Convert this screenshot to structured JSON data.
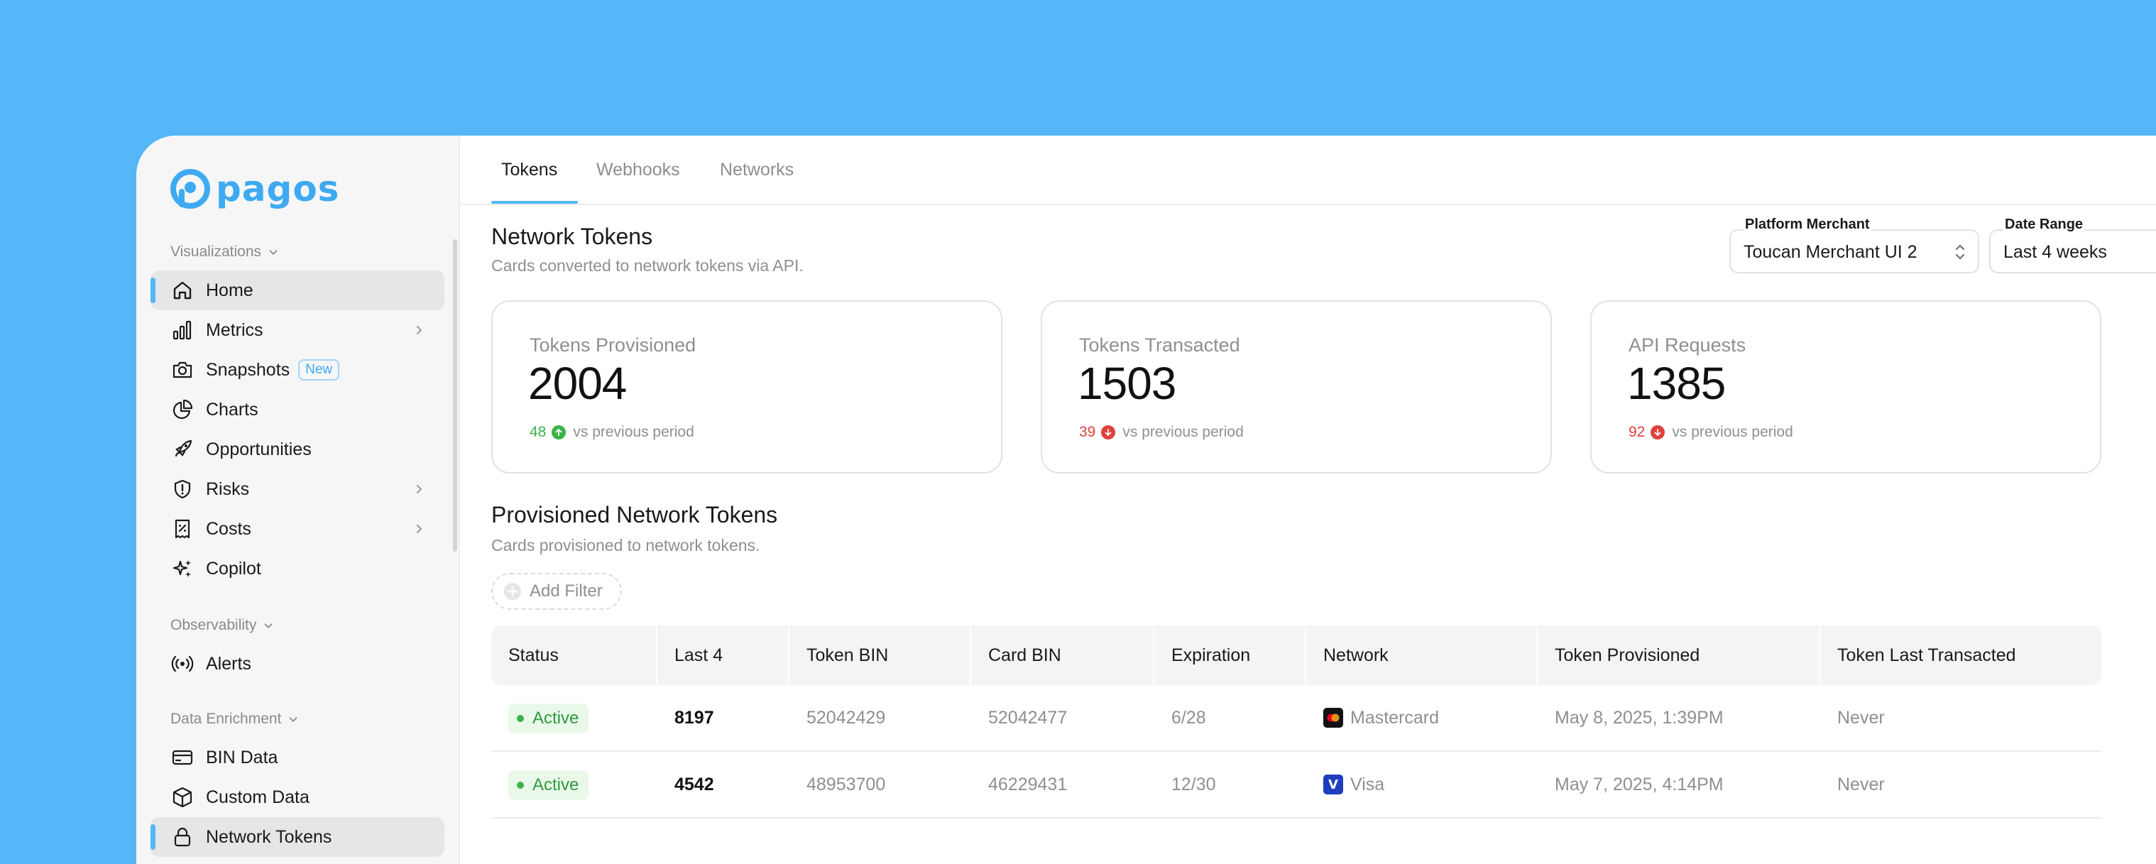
{
  "app": {
    "logo_text": "pagos",
    "brand_color": "#3eaaf2",
    "accent_color": "#55b6f8"
  },
  "sidebar": {
    "sections": [
      {
        "label": "Visualizations"
      },
      {
        "label": "Observability"
      },
      {
        "label": "Data Enrichment"
      }
    ],
    "items": [
      {
        "label": "Home",
        "icon": "home-icon"
      },
      {
        "label": "Metrics",
        "icon": "bar-chart-icon"
      },
      {
        "label": "Snapshots",
        "icon": "camera-icon",
        "badge": "New"
      },
      {
        "label": "Charts",
        "icon": "pie-chart-icon"
      },
      {
        "label": "Opportunities",
        "icon": "rocket-icon"
      },
      {
        "label": "Risks",
        "icon": "shield-alert-icon"
      },
      {
        "label": "Costs",
        "icon": "receipt-percent-icon"
      },
      {
        "label": "Copilot",
        "icon": "sparkles-icon"
      },
      {
        "label": "Alerts",
        "icon": "broadcast-icon"
      },
      {
        "label": "BIN Data",
        "icon": "credit-card-icon"
      },
      {
        "label": "Custom Data",
        "icon": "box-icon"
      },
      {
        "label": "Network Tokens",
        "icon": "lock-icon"
      }
    ]
  },
  "tabs": [
    {
      "label": "Tokens",
      "active": true
    },
    {
      "label": "Webhooks",
      "active": false
    },
    {
      "label": "Networks",
      "active": false
    }
  ],
  "header": {
    "title": "Network Tokens",
    "subtitle": "Cards converted to network tokens via API."
  },
  "filters": {
    "merchant": {
      "label": "Platform Merchant",
      "value": "Toucan Merchant UI 2"
    },
    "date_range": {
      "label": "Date Range",
      "value": "Last 4 weeks"
    }
  },
  "cards": [
    {
      "label": "Tokens Provisioned",
      "value": "2004",
      "delta": "48",
      "direction": "up",
      "compare": "vs previous period"
    },
    {
      "label": "Tokens Transacted",
      "value": "1503",
      "delta": "39",
      "direction": "down",
      "compare": "vs previous period"
    },
    {
      "label": "API Requests",
      "value": "1385",
      "delta": "92",
      "direction": "down",
      "compare": "vs previous period"
    }
  ],
  "provisioned": {
    "title": "Provisioned Network Tokens",
    "subtitle": "Cards provisioned to network tokens.",
    "add_filter": "Add Filter",
    "columns": [
      "Status",
      "Last 4",
      "Token BIN",
      "Card BIN",
      "Expiration",
      "Network",
      "Token Provisioned",
      "Token Last Transacted"
    ],
    "rows": [
      {
        "status": "Active",
        "last4": "8197",
        "token_bin": "52042429",
        "card_bin": "52042477",
        "expiration": "6/28",
        "network": "Mastercard",
        "network_icon": "mastercard-icon",
        "provisioned": "May 8, 2025, 1:39PM",
        "last_transacted": "Never"
      },
      {
        "status": "Active",
        "last4": "4542",
        "token_bin": "48953700",
        "card_bin": "46229431",
        "expiration": "12/30",
        "network": "Visa",
        "network_icon": "visa-icon",
        "visa_letter": "V",
        "provisioned": "May 7, 2025, 4:14PM",
        "last_transacted": "Never"
      }
    ]
  }
}
